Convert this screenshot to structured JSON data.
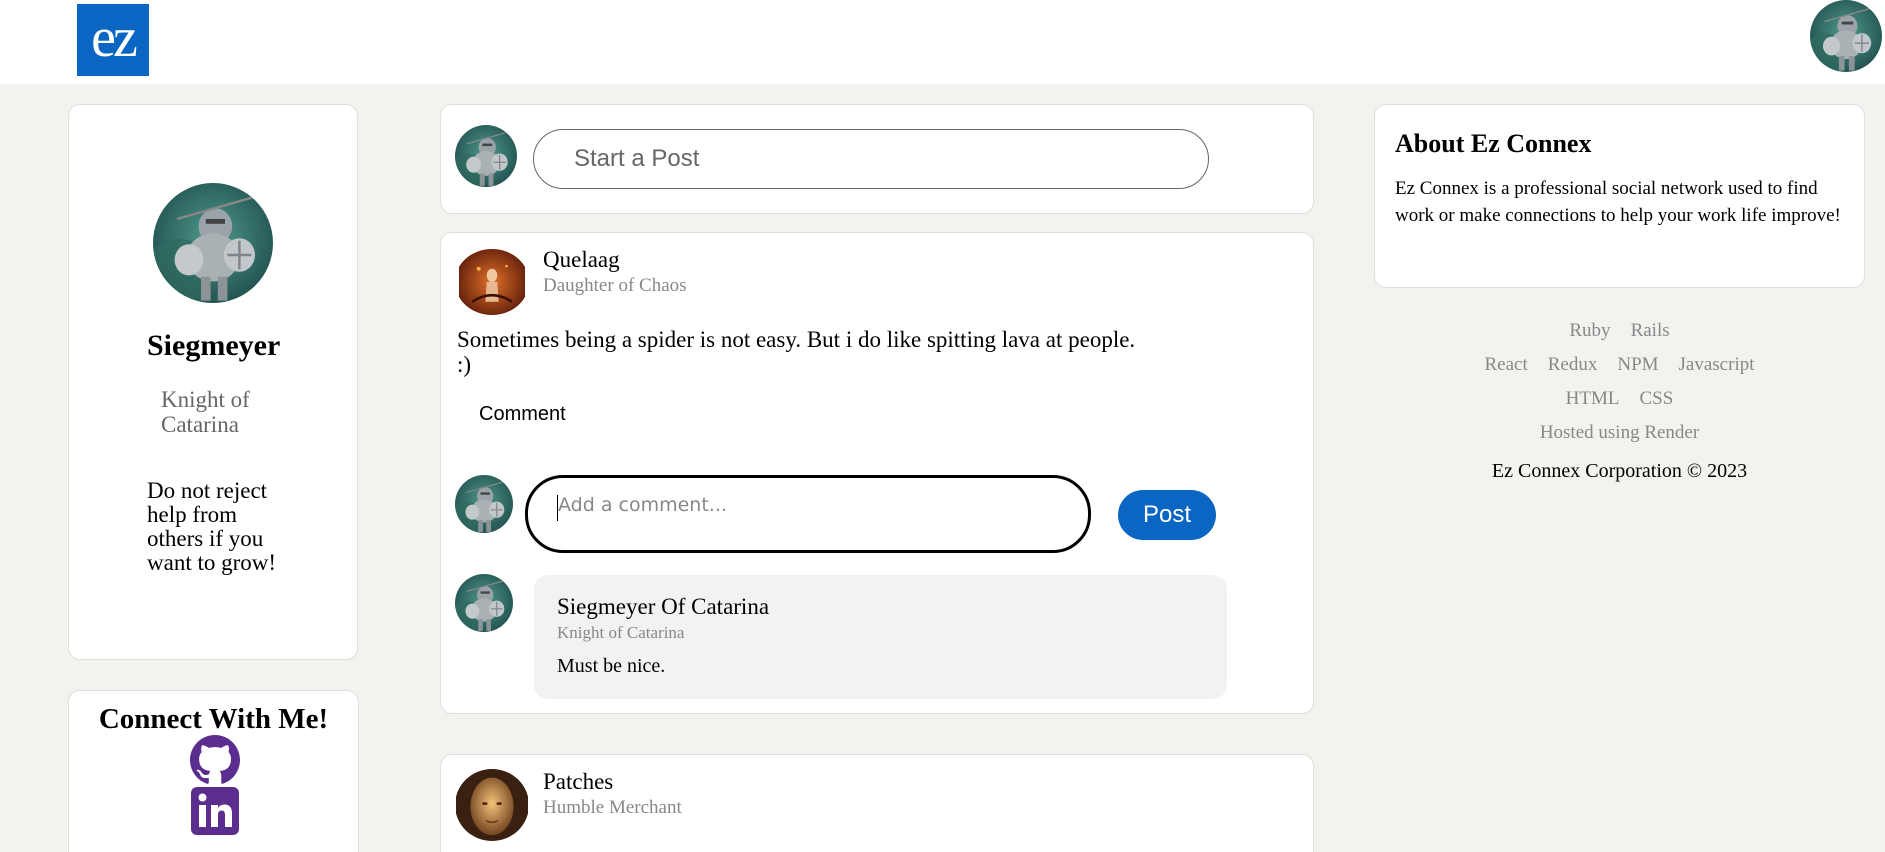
{
  "app": {
    "logo_text": "ez"
  },
  "profile": {
    "name": "Siegmeyer",
    "headline": "Knight of Catarina",
    "bio": "Do not reject help from others if you want to grow!"
  },
  "connect": {
    "title": "Connect With Me!"
  },
  "composer": {
    "placeholder": "Start a Post"
  },
  "posts": [
    {
      "author": "Quelaag",
      "headline": "Daughter of Chaos",
      "body_line1": "Sometimes being a spider is not easy. But i do like spitting lava at people.",
      "body_line2": ":)",
      "comment_label": "Comment",
      "comment_placeholder": "Add a comment...",
      "post_button": "Post",
      "comments": [
        {
          "author": "Siegmeyer Of Catarina",
          "headline": "Knight of Catarina",
          "text": "Must be nice."
        }
      ]
    },
    {
      "author": "Patches",
      "headline": "Humble Merchant"
    }
  ],
  "about": {
    "title": "About Ez Connex",
    "text": "Ez Connex is a professional social network used to find work or make connections to help your work life improve!"
  },
  "footer": {
    "row1": [
      "Ruby",
      "Rails"
    ],
    "row2": [
      "React",
      "Redux",
      "NPM",
      "Javascript"
    ],
    "row3": [
      "HTML",
      "CSS"
    ],
    "hosted": "Hosted using Render",
    "copyright": "Ez Connex Corporation © 2023"
  },
  "colors": {
    "brand": "#0a66c2",
    "page_bg": "#f3f2ef",
    "social_icon": "#5b2d8e"
  },
  "icons": [
    "knight-avatar",
    "spider-avatar",
    "merchant-avatar",
    "github-icon",
    "linkedin-icon"
  ]
}
